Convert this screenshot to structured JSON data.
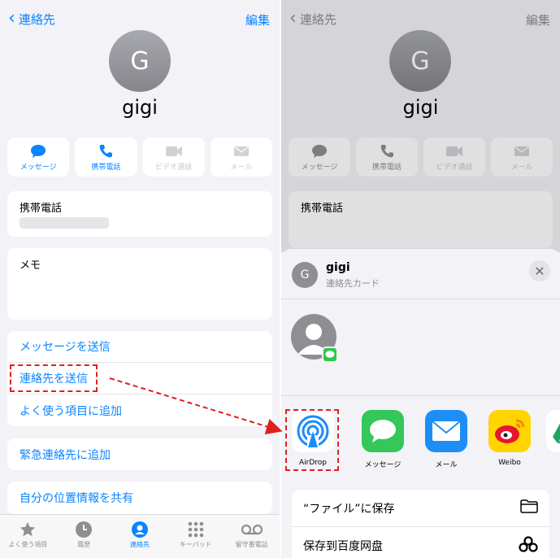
{
  "left": {
    "nav": {
      "back": "連絡先",
      "edit": "編集"
    },
    "contact": {
      "initial": "G",
      "name": "gigi"
    },
    "actions": [
      {
        "label": "メッセージ",
        "icon": "message-bubble-icon",
        "enabled": true
      },
      {
        "label": "携帯電話",
        "icon": "phone-icon",
        "enabled": true
      },
      {
        "label": "ビデオ通話",
        "icon": "video-icon",
        "enabled": false
      },
      {
        "label": "メール",
        "icon": "mail-icon",
        "enabled": false
      }
    ],
    "phone_label": "携帯電話",
    "memo_label": "メモ",
    "options_group": [
      "メッセージを送信",
      "連絡先を送信",
      "よく使う項目に追加"
    ],
    "emergency": "緊急連絡先に追加",
    "share_location": "自分の位置情報を共有",
    "tabs": [
      {
        "label": "よく使う項目",
        "icon": "star-icon"
      },
      {
        "label": "履歴",
        "icon": "clock-icon"
      },
      {
        "label": "連絡先",
        "icon": "person-circle-icon",
        "active": true
      },
      {
        "label": "キーパッド",
        "icon": "keypad-icon"
      },
      {
        "label": "留守番電話",
        "icon": "voicemail-icon"
      }
    ]
  },
  "right": {
    "nav": {
      "back": "連絡先",
      "edit": "編集"
    },
    "contact": {
      "initial": "G",
      "name": "gigi"
    },
    "actions": [
      {
        "label": "メッセージ"
      },
      {
        "label": "携帯電話"
      },
      {
        "label": "ビデオ通話"
      },
      {
        "label": "メール"
      }
    ],
    "phone_label": "携帯電話",
    "sheet": {
      "initial": "G",
      "title": "gigi",
      "subtitle": "連絡先カード",
      "close": "✕",
      "apps": [
        {
          "label": "AirDrop",
          "icon": "airdrop-icon"
        },
        {
          "label": "メッセージ",
          "icon": "messages-app-icon"
        },
        {
          "label": "メール",
          "icon": "mail-app-icon"
        },
        {
          "label": "Weibo",
          "icon": "weibo-icon"
        }
      ],
      "rows": [
        {
          "label": "“ファイル”に保存",
          "icon": "folder-icon"
        },
        {
          "label": "保存到百度网盘",
          "icon": "baidu-netdisk-icon"
        }
      ]
    }
  },
  "colors": {
    "accent": "#0a84ff",
    "annotation": "#e02020"
  }
}
